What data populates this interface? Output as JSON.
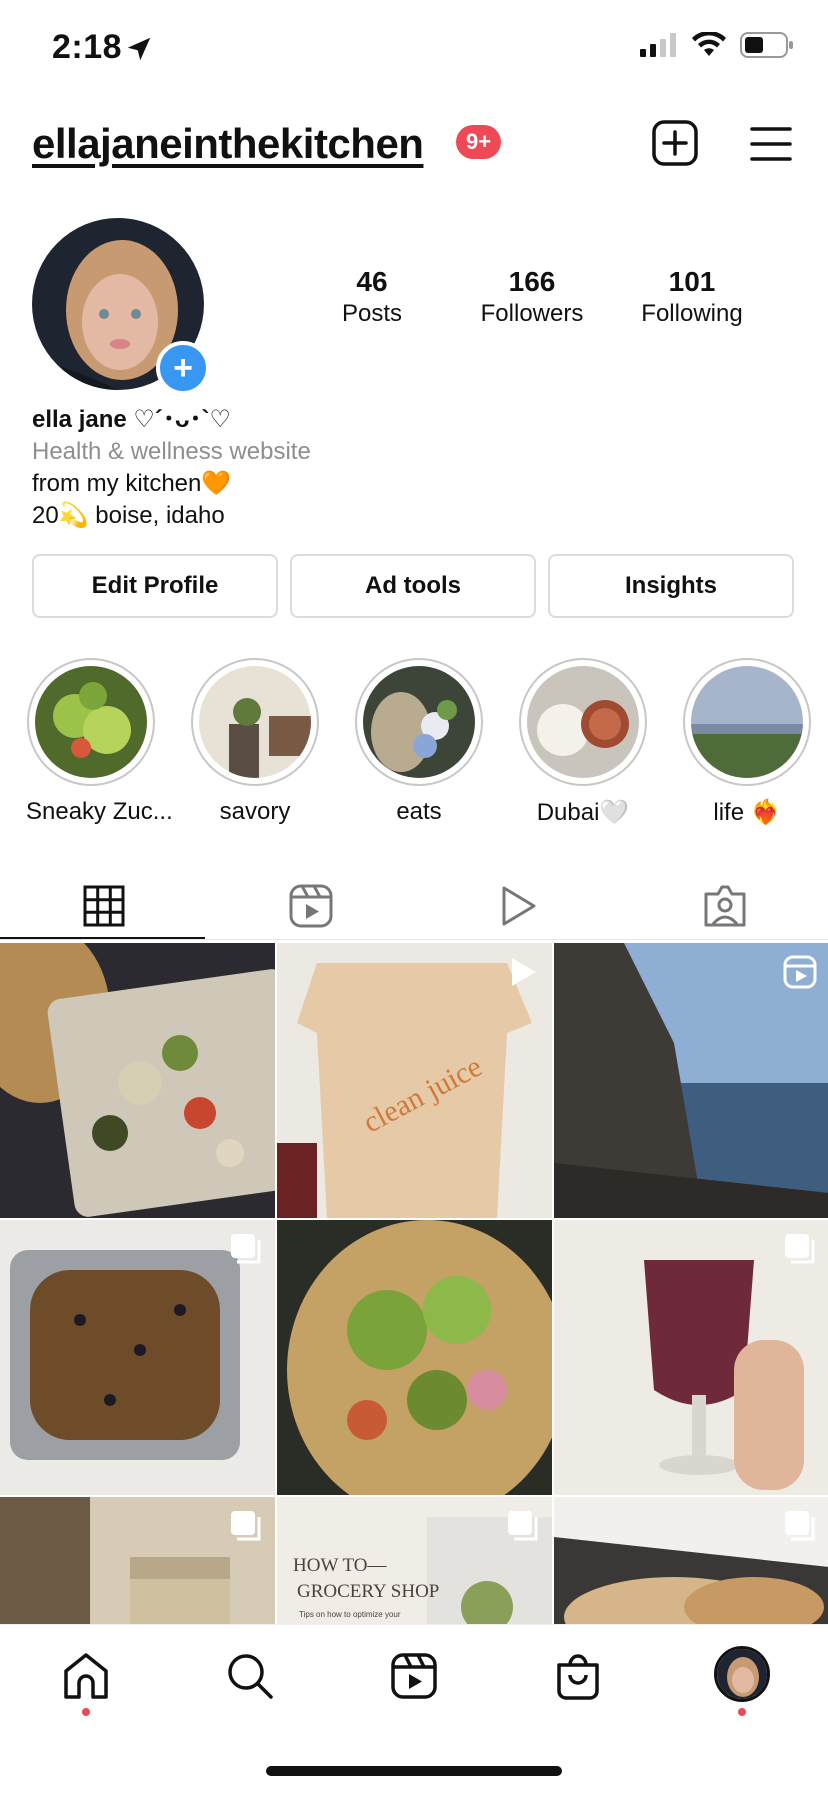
{
  "status_bar": {
    "time": "2:18"
  },
  "header": {
    "username": "ellajaneinthekitchen",
    "notification_count": "9+"
  },
  "profile": {
    "stats": [
      {
        "value": "46",
        "label": "Posts"
      },
      {
        "value": "166",
        "label": "Followers"
      },
      {
        "value": "101",
        "label": "Following"
      }
    ],
    "name": "ella jane ♡´･ᴗ･`♡",
    "category": "Health & wellness website",
    "bio_lines": [
      "from my kitchen🧡",
      "20💫 boise, idaho"
    ]
  },
  "buttons": {
    "edit_profile": "Edit Profile",
    "ad_tools": "Ad tools",
    "insights": "Insights"
  },
  "highlights": [
    {
      "label": "Sneaky Zuc..."
    },
    {
      "label": "savory"
    },
    {
      "label": "eats"
    },
    {
      "label": "Dubai🤍"
    },
    {
      "label": "life ❤️‍🔥"
    }
  ],
  "tabs": [
    "grid-icon",
    "reels-icon",
    "play-icon",
    "tagged-icon"
  ],
  "grid_texts": {
    "how_to_title_1": "HOW TO—",
    "how_to_title_2": "GROCERY SHOP",
    "how_to_sub": "Tips on how to optimize your",
    "shirt_text": "clean juice"
  },
  "colors": {
    "accent_blue": "#3897f0",
    "badge_red": "#ed4956"
  },
  "bottom_nav": [
    "home-icon",
    "search-icon",
    "reels-icon",
    "shop-icon",
    "profile-avatar"
  ]
}
